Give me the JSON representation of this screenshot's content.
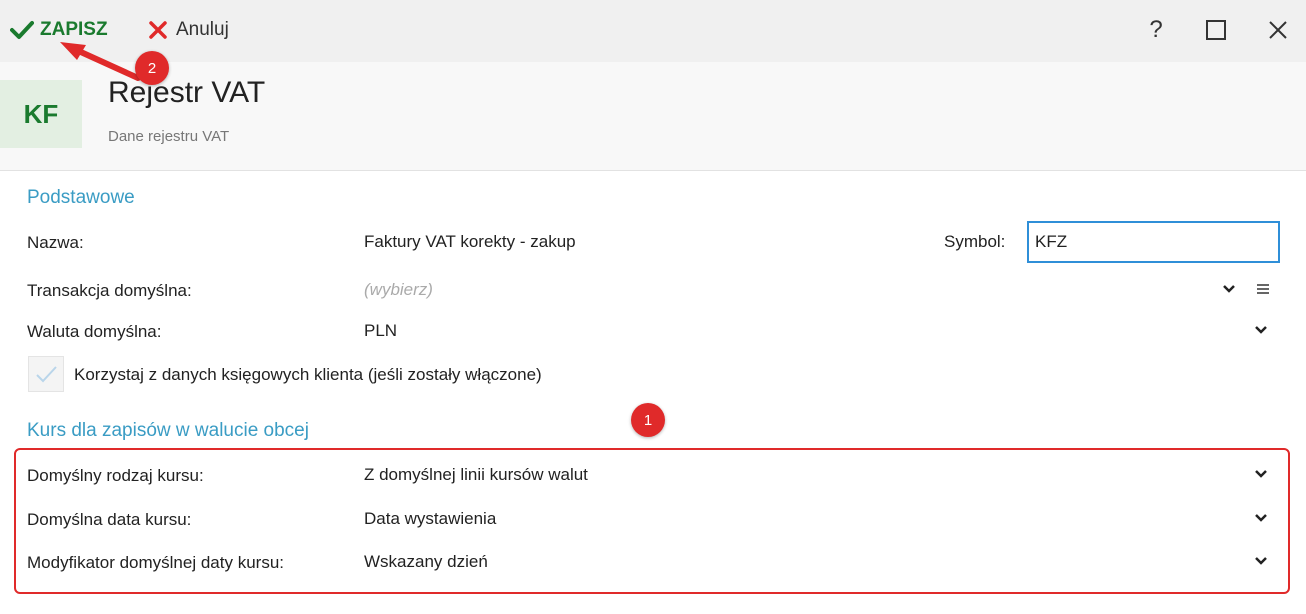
{
  "toolbar": {
    "save_label": "ZAPISZ",
    "cancel_label": "Anuluj",
    "help_label": "?"
  },
  "header": {
    "logo_text": "KF",
    "title": "Rejestr VAT",
    "subtitle": "Dane rejestru VAT"
  },
  "basic": {
    "section_title": "Podstawowe",
    "name_label": "Nazwa:",
    "name_value": "Faktury VAT korekty - zakup",
    "symbol_label": "Symbol:",
    "symbol_value": "KFZ",
    "transaction_label": "Transakcja domyślna:",
    "transaction_placeholder": "(wybierz)",
    "currency_label": "Waluta domyślna:",
    "currency_value": "PLN",
    "checkbox_label": "Korzystaj z danych księgowych klienta (jeśli zostały włączone)"
  },
  "rate": {
    "section_title": "Kurs dla zapisów w walucie obcej",
    "rate_type_label": "Domyślny rodzaj kursu:",
    "rate_type_value": "Z domyślnej linii kursów walut",
    "rate_date_label": "Domyślna data kursu:",
    "rate_date_value": "Data wystawienia",
    "rate_modifier_label": "Modyfikator domyślnej daty kursu:",
    "rate_modifier_value": "Wskazany dzień"
  },
  "annotations": {
    "badge_1": "1",
    "badge_2": "2"
  },
  "colors": {
    "accent_green": "#1a7a2e",
    "section_blue": "#3a9cc4",
    "focus_blue": "#2f8fd8",
    "annotation_red": "#e02a2a"
  }
}
